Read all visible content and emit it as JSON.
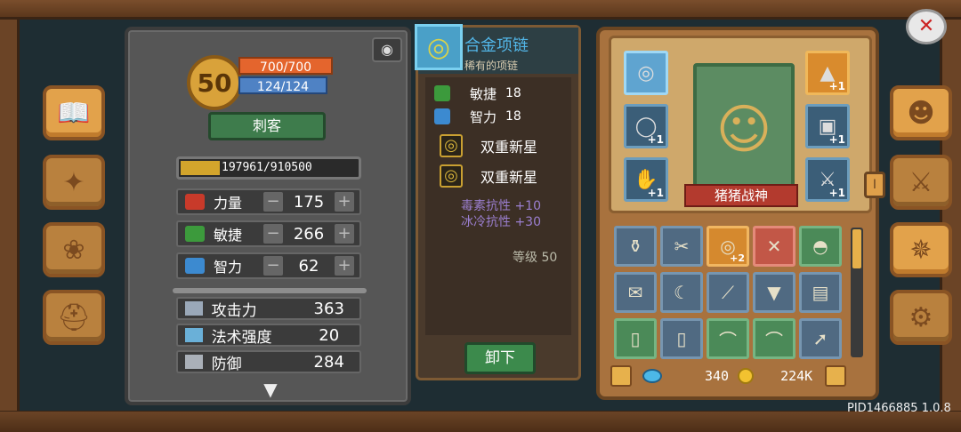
{
  "left_menu": {
    "buttons": [
      {
        "name": "book",
        "glyph": "📖"
      },
      {
        "name": "scroll",
        "glyph": "✦"
      },
      {
        "name": "paw",
        "glyph": "❀"
      },
      {
        "name": "helmet",
        "glyph": "⛑"
      }
    ]
  },
  "stats": {
    "level": "50",
    "hp": "700/700",
    "mp": "124/124",
    "class_label": "刺客",
    "exp_text": "197961/910500",
    "exp_fraction": 0.22,
    "attributes": [
      {
        "label": "力量",
        "value": "175",
        "icon_color": "#c83a2a"
      },
      {
        "label": "敏捷",
        "value": "266",
        "icon_color": "#3c9a3c"
      },
      {
        "label": "智力",
        "value": "62",
        "icon_color": "#3c8ad0"
      }
    ],
    "combat": [
      {
        "label": "攻击力",
        "value": "363",
        "icon_color": "#9aa8b8"
      },
      {
        "label": "法术强度",
        "value": "20",
        "icon_color": "#6ab0d8"
      },
      {
        "label": "防御",
        "value": "284",
        "icon_color": "#aab0b8"
      }
    ]
  },
  "item": {
    "name": "合金项链",
    "rarity": "稀有的项链",
    "attrs": [
      {
        "label": "敏捷",
        "value": "18",
        "icon_color": "#3c9a3c"
      },
      {
        "label": "智力",
        "value": "18",
        "icon_color": "#3c8ad0"
      }
    ],
    "skills": [
      "双重新星",
      "双重新星"
    ],
    "resists": [
      "毒素抗性 +10",
      "冰冷抗性 +30"
    ],
    "level_text": "等级 50",
    "unequip_label": "卸下"
  },
  "character": {
    "name": "猪猪战神",
    "side_tab": "I"
  },
  "currency": {
    "gems": "340",
    "gold": "224K"
  },
  "footer": {
    "pid": "PID1466885 1.0.8"
  }
}
